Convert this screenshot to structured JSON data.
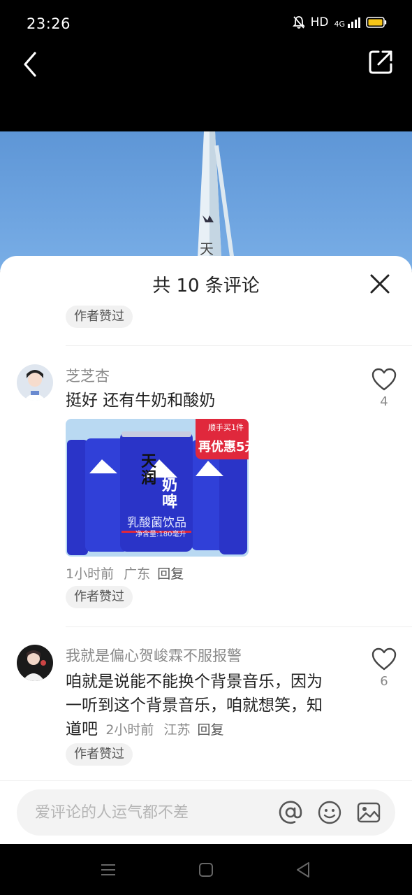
{
  "status": {
    "time": "23:26",
    "hd": "HD",
    "network": "4G"
  },
  "icons": {
    "back": "back-icon",
    "share": "share-icon",
    "close": "close-icon",
    "like": "heart-icon",
    "at": "at-icon",
    "emoji": "emoji-icon",
    "image": "image-icon"
  },
  "sheet": {
    "title": "共 10 条评论",
    "author_liked_label": "作者赞过"
  },
  "comments": [
    {
      "author": "芝芝杏",
      "text": "挺好 还有牛奶和酸奶",
      "time": "1小时前",
      "location": "广东",
      "reply_label": "回复",
      "likes": "4",
      "image": {
        "brand_line1": "天",
        "brand_line2": "润",
        "product_line1": "奶",
        "product_line2": "啤",
        "product_desc": "乳酸菌饮品",
        "volume": "净含量:180毫升",
        "promo_top": "顺手买1件",
        "promo_main": "再优惠5元"
      }
    },
    {
      "author": "我就是偏心贺峻霖不服报警",
      "text_line1": "咱就是说能不能换个背景音乐，因为",
      "text_line2": "一听到这个背景音乐，咱就想笑，知",
      "text_line3": "道吧",
      "time": "2小时前",
      "location": "江苏",
      "reply_label": "回复",
      "likes": "6"
    }
  ],
  "input": {
    "placeholder": "爱评论的人运气都不差"
  },
  "video": {
    "tower_char": "天"
  },
  "colors": {
    "can_blue": "#2a34c8",
    "promo_red": "#e0283c",
    "sky_blue": "#6ea4e0"
  }
}
